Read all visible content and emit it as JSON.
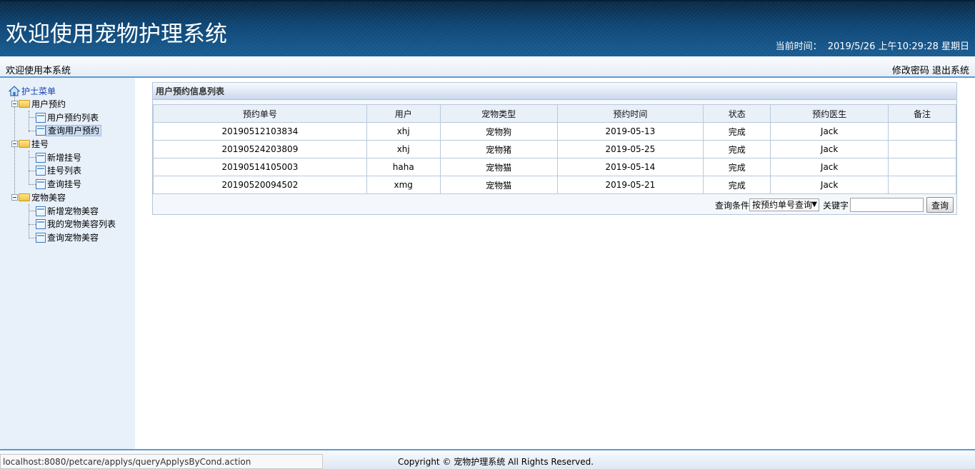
{
  "header": {
    "title": "欢迎使用宠物护理系统",
    "time_label": "当前时间：",
    "time_value": "2019/5/26 上午10:29:28 星期日"
  },
  "topbar": {
    "welcome": "欢迎使用本系统",
    "change_password": "修改密码",
    "logout": "退出系统"
  },
  "sidebar": {
    "root": "护士菜单",
    "groups": [
      {
        "label": "用户预约",
        "items": [
          "用户预约列表",
          "查询用户预约"
        ]
      },
      {
        "label": "挂号",
        "items": [
          "新增挂号",
          "挂号列表",
          "查询挂号"
        ]
      },
      {
        "label": "宠物美容",
        "items": [
          "新增宠物美容",
          "我的宠物美容列表",
          "查询宠物美容"
        ]
      }
    ],
    "selected_item": "查询用户预约"
  },
  "panel": {
    "title": "用户预约信息列表",
    "columns": [
      "预约单号",
      "用户",
      "宠物类型",
      "预约时间",
      "状态",
      "预约医生",
      "备注"
    ],
    "rows": [
      [
        "20190512103834",
        "xhj",
        "宠物狗",
        "2019-05-13",
        "完成",
        "Jack",
        ""
      ],
      [
        "20190524203809",
        "xhj",
        "宠物猪",
        "2019-05-25",
        "完成",
        "Jack",
        ""
      ],
      [
        "20190514105003",
        "haha",
        "宠物猫",
        "2019-05-14",
        "完成",
        "Jack",
        ""
      ],
      [
        "20190520094502",
        "xmg",
        "宠物猫",
        "2019-05-21",
        "完成",
        "Jack",
        ""
      ]
    ],
    "search": {
      "condition_label": "查询条件",
      "condition_value": "按预约单号查询",
      "keyword_label": "关键字",
      "keyword_value": "",
      "button": "查询"
    }
  },
  "footer": {
    "copyright": "Copyright © 宠物护理系统 All Rights Reserved."
  },
  "status_bar": {
    "url": "localhost:8080/petcare/applys/queryApplysByCond.action"
  }
}
